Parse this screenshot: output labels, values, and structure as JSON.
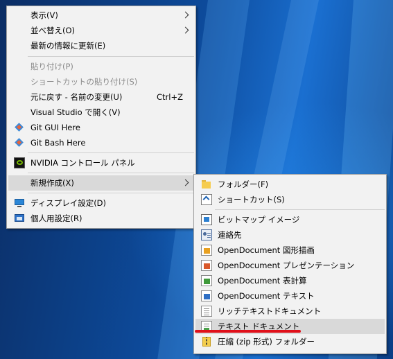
{
  "context_menu": {
    "items": [
      {
        "label": "表示(V)"
      },
      {
        "label": "並べ替え(O)"
      },
      {
        "label": "最新の情報に更新(E)"
      },
      {
        "label": "貼り付け(P)"
      },
      {
        "label": "ショートカットの貼り付け(S)"
      },
      {
        "label": "元に戻す - 名前の変更(U)",
        "shortcut": "Ctrl+Z"
      },
      {
        "label": "Visual Studio で開く(V)"
      },
      {
        "label": "Git GUI Here",
        "icon": "git-gui-icon"
      },
      {
        "label": "Git Bash Here",
        "icon": "git-bash-icon"
      },
      {
        "label": "NVIDIA コントロール パネル",
        "icon": "nvidia-icon"
      },
      {
        "label": "新規作成(X)"
      },
      {
        "label": "ディスプレイ設定(D)",
        "icon": "display-settings-icon"
      },
      {
        "label": "個人用設定(R)",
        "icon": "personalize-icon"
      }
    ]
  },
  "new_submenu": {
    "items": [
      {
        "label": "フォルダー(F)",
        "icon": "folder-icon"
      },
      {
        "label": "ショートカット(S)",
        "icon": "shortcut-icon"
      },
      {
        "label": "ビットマップ イメージ",
        "icon": "bitmap-icon"
      },
      {
        "label": "連絡先",
        "icon": "contact-icon"
      },
      {
        "label": "OpenDocument 図形描画",
        "icon": "od-drawing-icon"
      },
      {
        "label": "OpenDocument プレゼンテーション",
        "icon": "od-presentation-icon"
      },
      {
        "label": "OpenDocument 表計算",
        "icon": "od-spreadsheet-icon"
      },
      {
        "label": "OpenDocument テキスト",
        "icon": "od-text-icon"
      },
      {
        "label": "リッチテキストドキュメント",
        "icon": "rtf-icon"
      },
      {
        "label": "テキスト ドキュメント",
        "icon": "text-document-icon"
      },
      {
        "label": "圧縮 (zip 形式) フォルダー",
        "icon": "zip-folder-icon"
      }
    ]
  },
  "colors": {
    "menu_bg": "#f2f2f2",
    "highlight": "#d9d9d9",
    "disabled_text": "#8a8a8a",
    "annotation": "#e0101a"
  }
}
